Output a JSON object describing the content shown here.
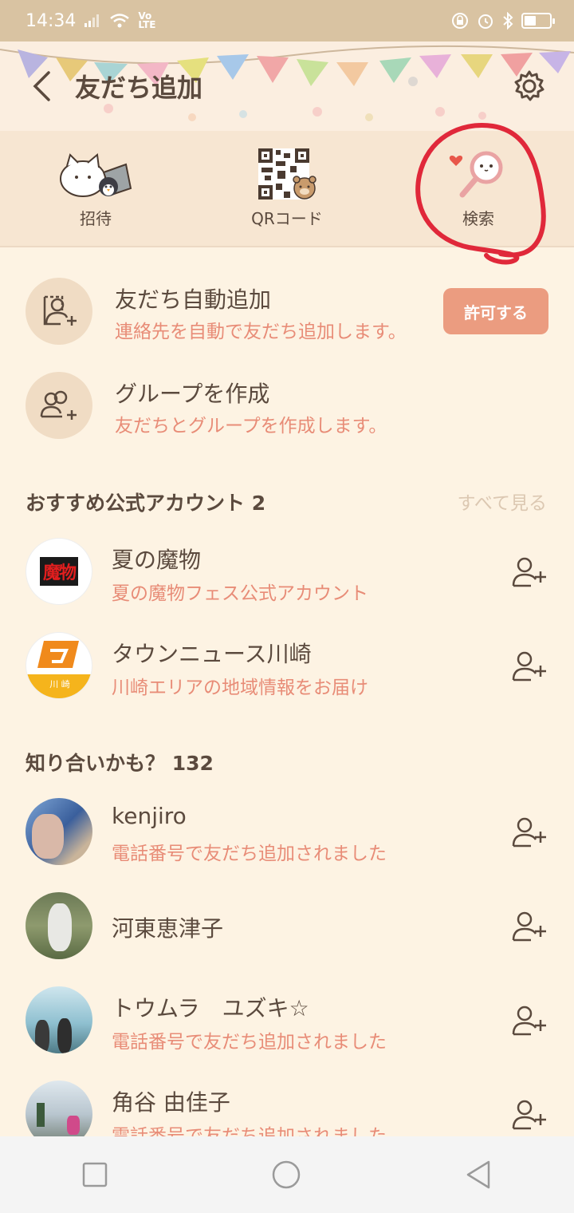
{
  "status_bar": {
    "time": "14:34",
    "network": "VoLTE"
  },
  "header": {
    "title": "友だち追加"
  },
  "options": [
    {
      "label": "招待",
      "icon": "invite-characters-icon"
    },
    {
      "label": "QRコード",
      "icon": "qr-code-icon"
    },
    {
      "label": "検索",
      "icon": "search-magnifier-icon"
    }
  ],
  "actions": {
    "auto_add": {
      "title": "友だち自動追加",
      "desc": "連絡先を自動で友だち追加します。",
      "button": "許可する"
    },
    "create_group": {
      "title": "グループを作成",
      "desc": "友だちとグループを作成します。"
    }
  },
  "recommended": {
    "heading": "おすすめ公式アカウント 2",
    "see_all": "すべて見る",
    "items": [
      {
        "name": "夏の魔物",
        "desc": "夏の魔物フェス公式アカウント",
        "logo_text": "魔物"
      },
      {
        "name": "タウンニュース川崎",
        "desc": "川崎エリアの地域情報をお届け",
        "logo_text": "川 崎"
      }
    ]
  },
  "maybe_know": {
    "heading": "知り合いかも？ 132",
    "items": [
      {
        "name": "kenjiro",
        "desc": "電話番号で友だち追加されました"
      },
      {
        "name": "河東恵津子",
        "desc": ""
      },
      {
        "name": "トウムラ　ユズキ☆",
        "desc": "電話番号で友だち追加されました"
      },
      {
        "name": "角谷 由佳子",
        "desc": "電話番号で友だち追加されました"
      }
    ]
  },
  "colors": {
    "accent": "#e88c77",
    "button": "#eb9c80",
    "background": "#fdf3e3",
    "annotation": "#e0283a"
  }
}
